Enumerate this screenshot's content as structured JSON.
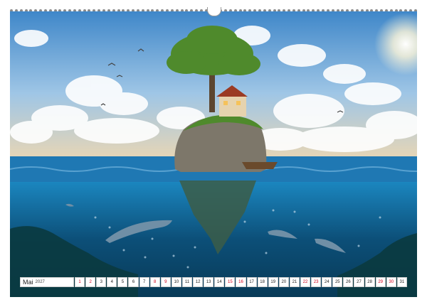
{
  "calendar": {
    "month": "Mai",
    "year": "2027",
    "days": [
      "1",
      "2",
      "3",
      "4",
      "5",
      "6",
      "7",
      "8",
      "9",
      "10",
      "11",
      "12",
      "13",
      "14",
      "15",
      "16",
      "17",
      "18",
      "19",
      "20",
      "21",
      "22",
      "23",
      "24",
      "25",
      "26",
      "27",
      "28",
      "29",
      "30",
      "31"
    ],
    "highlighted_days": [
      "1",
      "2",
      "8",
      "9",
      "15",
      "16",
      "22",
      "23",
      "29",
      "30"
    ],
    "highlight_color": "#d0021b"
  },
  "photo": {
    "sky_colors": [
      "#3f87c9",
      "#9fc6e6",
      "#e9d6b4"
    ],
    "sea_surface_color": "#1f78b3",
    "underwater_colors": [
      "#1b86bf",
      "#0c4f78",
      "#083a57"
    ],
    "tree_color": "#4f8a2c",
    "house_roof_color": "#9b3b24"
  }
}
